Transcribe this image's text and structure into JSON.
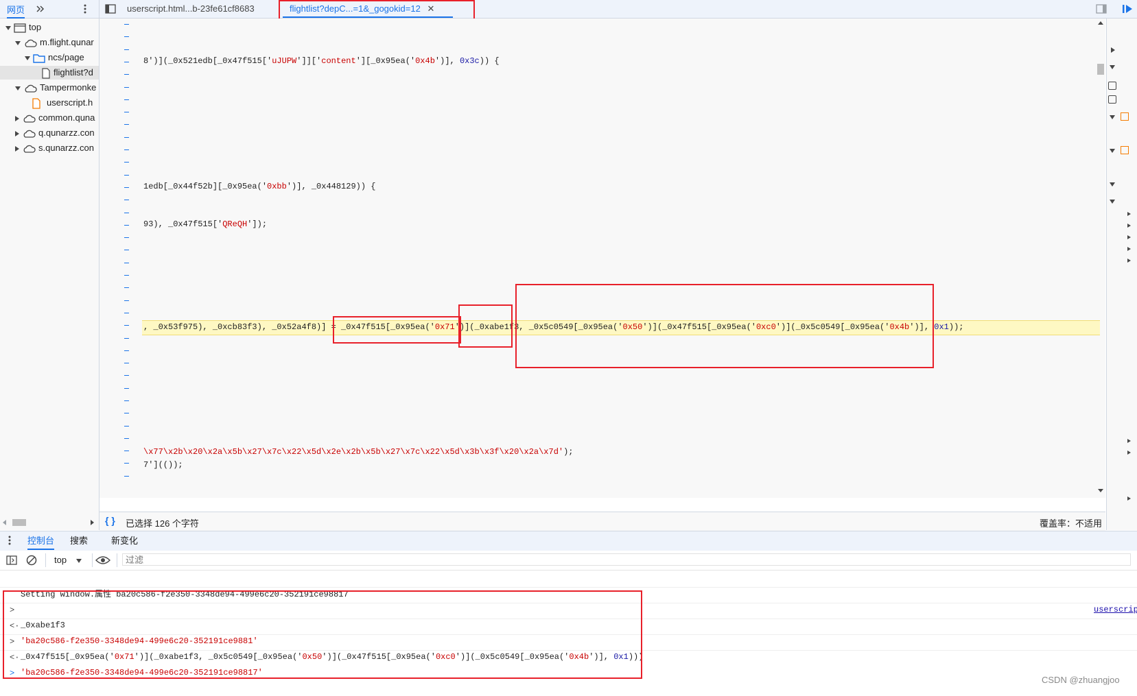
{
  "topbar": {
    "nav_tab_label": "网页",
    "file_tabs": [
      {
        "label": "userscript.html...b-23fe61cf8683",
        "active": false
      },
      {
        "label": "flightlist?depC...=1&_gogokid=12",
        "active": true
      }
    ],
    "close_glyph": "✕"
  },
  "file_tree": [
    {
      "label": "top",
      "icon": "frame-icon",
      "depth": 0,
      "expanded": true
    },
    {
      "label": "m.flight.qunar",
      "icon": "cloud-icon",
      "depth": 1,
      "expanded": true
    },
    {
      "label": "ncs/page",
      "icon": "folder-icon",
      "depth": 2,
      "expanded": true
    },
    {
      "label": "flightlist?d",
      "icon": "file-icon",
      "depth": 3,
      "expanded": null,
      "selected": true
    },
    {
      "label": "Tampermonke",
      "icon": "cloud-icon",
      "depth": 1,
      "expanded": true
    },
    {
      "label": "userscript.h",
      "icon": "script-file-icon",
      "depth": 2,
      "expanded": null
    },
    {
      "label": "common.quna",
      "icon": "cloud-icon",
      "depth": 1,
      "expanded": false
    },
    {
      "label": "q.qunarzz.con",
      "icon": "cloud-icon",
      "depth": 1,
      "expanded": false
    },
    {
      "label": "s.qunarzz.con",
      "icon": "cloud-icon",
      "depth": 1,
      "expanded": false
    }
  ],
  "editor": {
    "line1_prefix": "8')](_0x521edb[_0x47f515['",
    "line1_s1": "uJUPW",
    "line1_mid1": "']]['",
    "line1_s2": "content",
    "line1_mid2": "'][_0x95ea('",
    "line1_s3": "0x4b",
    "line1_mid3": "')], ",
    "line1_n1": "0x3c",
    "line1_suffix": ")) {",
    "line2_prefix": "1edb[_0x44f52b][_0x95ea('",
    "line2_s1": "0xbb",
    "line2_suffix": "')], _0x448129)) {",
    "line3_prefix": "93), _0x47f515['",
    "line3_s1": "QReQH",
    "line3_suffix": "']);",
    "line4_a": ", _0x53f975), _0xcb83f3), _0x52a4f8)] = _0x47f515[_0x95ea('",
    "line4_s1": "0x71",
    "line4_b": "')](_0xabe1f3, _0x5c0549[_0x95ea('",
    "line4_s2": "0x50",
    "line4_c": "')](_0x47f515[_0x95ea('",
    "line4_s3": "0xc0",
    "line4_d": "')](_0x5c0549[_0x95ea('",
    "line4_s4": "0x4b",
    "line4_e": "')], ",
    "line4_n1": "0x1",
    "line4_f": "));",
    "line5": "\\x77\\x2b\\x20\\x2a\\x5b\\x27\\x7c\\x22\\x5d\\x2e\\x2b\\x5b\\x27\\x7c\\x22\\x5d\\x3b\\x3f\\x20\\x2a\\x7d'",
    "line5_suffix": ");",
    "line6": "7'](());"
  },
  "status": {
    "selection_text": "已选择 126 个字符",
    "coverage_text": "覆盖率：不适用"
  },
  "drawer": {
    "tabs": [
      "控制台",
      "搜索",
      "新变化"
    ],
    "active_tab": "控制台",
    "context_label": "top",
    "filter_placeholder": "过滤"
  },
  "console": {
    "log_text": "Setting window.属性 ba20c586-f2e350-3348de94-499e6c20-352191ce98817",
    "log_source": "userscrip",
    "entries": [
      {
        "kind": "input",
        "text": "_0xabe1f3"
      },
      {
        "kind": "result",
        "text": "'ba20c586-f2e350-3348de94-499e6c20-352191ce9881'"
      },
      {
        "kind": "input",
        "text_a": "_0x47f515[_0x95ea('",
        "s1": "0x71",
        "text_b": "')](_0xabe1f3, _0x5c0549[_0x95ea('",
        "s2": "0x50",
        "text_c": "')](_0x47f515[_0x95ea('",
        "s3": "0xc0",
        "text_d": "')](_0x5c0549[_0x95ea('",
        "s4": "0x4b",
        "text_e": "')], ",
        "n1": "0x1",
        "text_f": ")))"
      },
      {
        "kind": "result",
        "text": "'ba20c586-f2e350-3348de94-499e6c20-352191ce98817'"
      }
    ],
    "watermark": "CSDN @zhuangjoo"
  },
  "colors": {
    "accent": "#1a73e8",
    "annotation_red": "#e8202a",
    "string_red": "#c80000",
    "number_blue": "#1a1aa6",
    "highlight_yellow": "#fef8c3"
  }
}
